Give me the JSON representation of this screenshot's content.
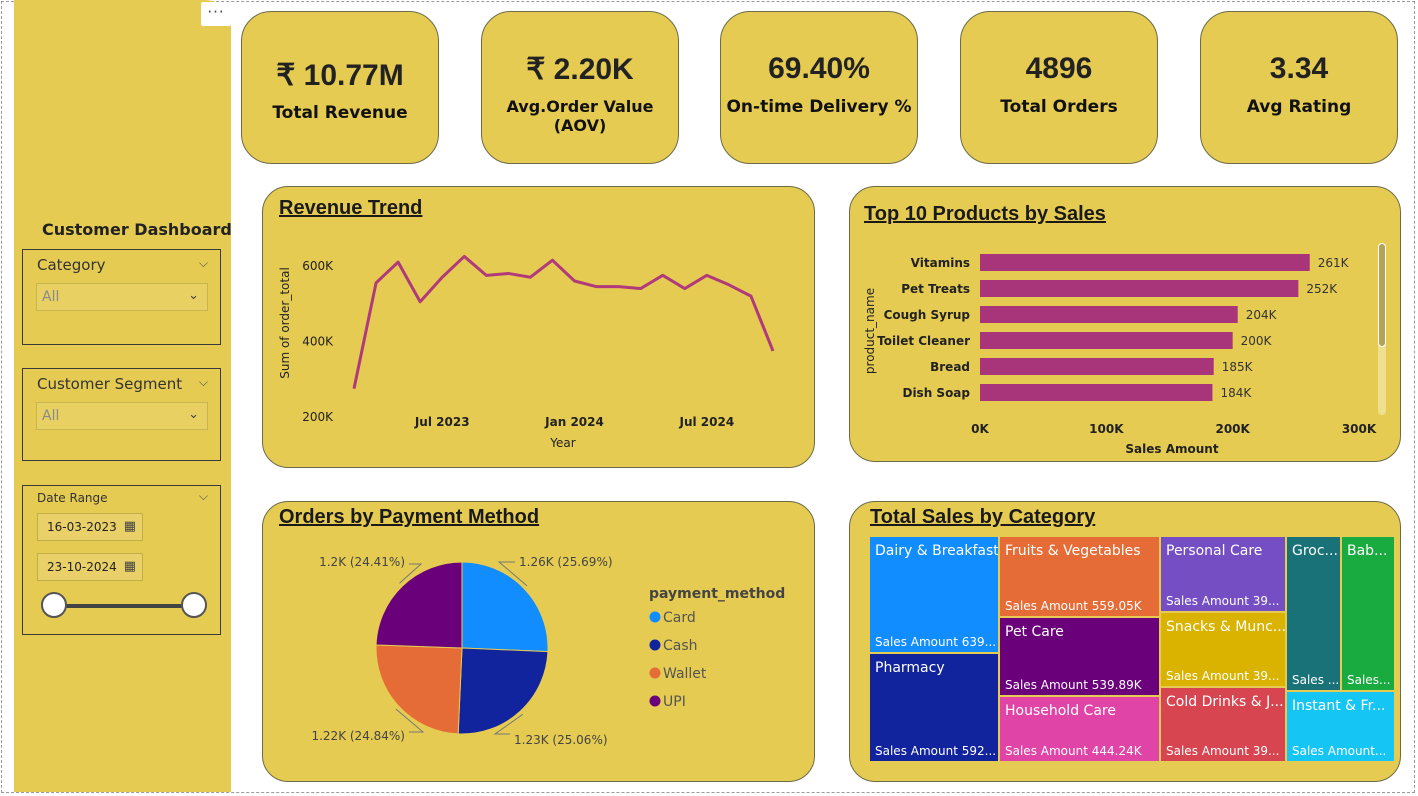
{
  "sidebar": {
    "more_label": "···",
    "title": "Customer Dashboard",
    "category": {
      "label": "Category",
      "value": "All"
    },
    "segment": {
      "label": "Customer Segment",
      "value": "All"
    },
    "date_range": {
      "label": "Date Range",
      "start": "16-03-2023",
      "end": "23-10-2024"
    }
  },
  "kpis": [
    {
      "value": "₹ 10.77M",
      "label": "Total Revenue"
    },
    {
      "value": "₹ 2.20K",
      "label": "Avg.Order Value (AOV)"
    },
    {
      "value": "69.40%",
      "label": "On-time Delivery %"
    },
    {
      "value": "4896",
      "label": "Total Orders"
    },
    {
      "value": "3.34",
      "label": "Avg Rating"
    }
  ],
  "charts": {
    "revenue_title": "Revenue Trend",
    "products_title": "Top 10 Products by Sales",
    "payment_title": "Orders by Payment Method",
    "category_title": "Total Sales by Category"
  },
  "chart_data": [
    {
      "type": "line",
      "title": "Revenue Trend",
      "xlabel": "Year",
      "ylabel": "Sum of order_total",
      "x_ticks": [
        "Jul 2023",
        "Jan 2024",
        "Jul 2024"
      ],
      "y_ticks": [
        "200K",
        "400K",
        "600K"
      ],
      "ylim": [
        200000,
        650000
      ],
      "x": [
        "2023-03",
        "2023-04",
        "2023-05",
        "2023-06",
        "2023-07",
        "2023-08",
        "2023-09",
        "2023-10",
        "2023-11",
        "2023-12",
        "2024-01",
        "2024-02",
        "2024-03",
        "2024-04",
        "2024-05",
        "2024-06",
        "2024-07",
        "2024-08",
        "2024-09",
        "2024-10"
      ],
      "values": [
        275000,
        555000,
        610000,
        505000,
        570000,
        625000,
        575000,
        580000,
        570000,
        615000,
        560000,
        545000,
        545000,
        540000,
        575000,
        540000,
        575000,
        550000,
        520000,
        375000
      ],
      "color": "#b03a7a"
    },
    {
      "type": "bar",
      "orientation": "horizontal",
      "title": "Top 10 Products by Sales",
      "xlabel": "Sales Amount",
      "ylabel": "product_name",
      "categories": [
        "Vitamins",
        "Pet Treats",
        "Cough Syrup",
        "Toilet Cleaner",
        "Bread",
        "Dish Soap"
      ],
      "values": [
        261000,
        252000,
        204000,
        200000,
        185000,
        184000
      ],
      "labels": [
        "261K",
        "252K",
        "204K",
        "200K",
        "185K",
        "184K"
      ],
      "x_ticks": [
        "0K",
        "100K",
        "200K",
        "300K"
      ],
      "xlim": [
        0,
        300000
      ],
      "color": "#a8357a"
    },
    {
      "type": "pie",
      "title": "Orders by Payment Method",
      "legend_title": "payment_method",
      "legend_position": "right",
      "categories": [
        "Card",
        "Cash",
        "Wallet",
        "UPI"
      ],
      "values": [
        1260,
        1230,
        1220,
        1200
      ],
      "labels": [
        "1.26K (25.69%)",
        "1.23K (25.06%)",
        "1.22K (24.84%)",
        "1.2K (24.41%)"
      ],
      "colors": [
        "#118dff",
        "#12239e",
        "#e66c37",
        "#6b007b"
      ]
    },
    {
      "type": "treemap",
      "title": "Total Sales by Category",
      "tiles": [
        {
          "name": "Dairy & Breakfast",
          "value_label": "Sales Amount 639...",
          "color": "#118dff"
        },
        {
          "name": "Pharmacy",
          "value_label": "Sales Amount 592...",
          "color": "#12239e"
        },
        {
          "name": "Fruits & Vegetables",
          "value_label": "Sales Amount 559.05K",
          "color": "#e66c37"
        },
        {
          "name": "Pet Care",
          "value_label": "Sales Amount 539.89K",
          "color": "#6b007b"
        },
        {
          "name": "Household Care",
          "value_label": "Sales Amount 444.24K",
          "color": "#e044a7"
        },
        {
          "name": "Personal Care",
          "value_label": "Sales Amount 39...",
          "color": "#744ec2"
        },
        {
          "name": "Snacks & Munc...",
          "value_label": "Sales Amount 39...",
          "color": "#d9b300"
        },
        {
          "name": "Cold Drinks & J...",
          "value_label": "Sales Amount 39...",
          "color": "#d64550"
        },
        {
          "name": "Groc...",
          "value_label": "Sales ...",
          "color": "#197278"
        },
        {
          "name": "Bab...",
          "value_label": "Sales...",
          "color": "#1aab40"
        },
        {
          "name": "Instant & Fr...",
          "value_label": "Sales Amount...",
          "color": "#15c6f4"
        }
      ]
    }
  ]
}
